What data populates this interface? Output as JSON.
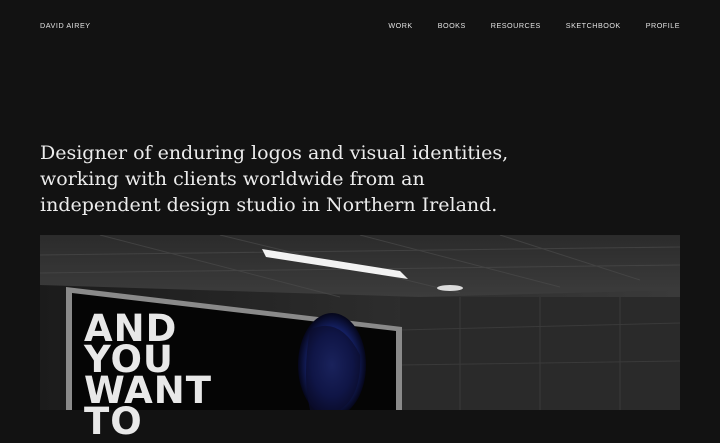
{
  "header": {
    "brand": "DAVID AIREY",
    "nav": [
      {
        "label": "WORK"
      },
      {
        "label": "BOOKS"
      },
      {
        "label": "RESOURCES"
      },
      {
        "label": "SKETCHBOOK"
      },
      {
        "label": "PROFILE"
      }
    ]
  },
  "hero": {
    "headline": "Designer of enduring logos and visual identities, working with clients worldwide from an independent design studio in Northern Ireland."
  },
  "featured_image": {
    "billboard_text": "AND\nYOU\nWANT\nTO"
  }
}
